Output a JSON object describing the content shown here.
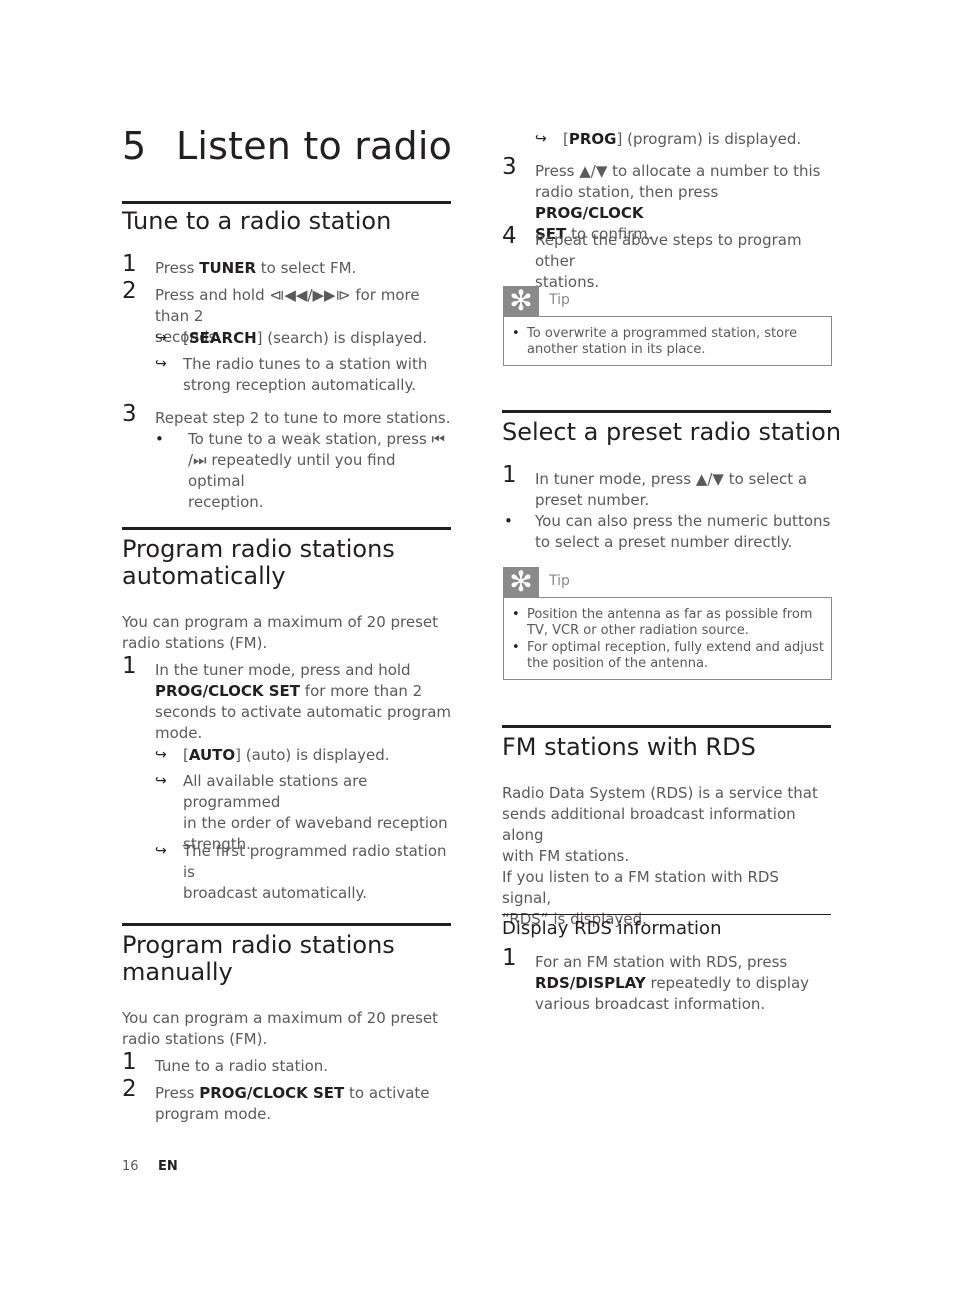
{
  "chapter": {
    "number": "5",
    "title": "Listen to radio"
  },
  "sections": {
    "tune": {
      "title": "Tune to a radio station",
      "steps": [
        {
          "n": "1",
          "pre": "Press ",
          "key": "TUNER",
          "post": " to select FM."
        },
        {
          "n": "2",
          "text": "Press and hold ⧏◀◀/▶▶⧐ for more than 2\nseconds."
        },
        {
          "n": "3",
          "text": "Repeat step 2 to tune to more stations."
        }
      ],
      "results": [
        {
          "pre": "[",
          "key": "SEARCH",
          "post": "] (search) is displayed."
        },
        {
          "text": "The radio tunes to a station with\nstrong reception automatically."
        }
      ],
      "bullets": [
        {
          "text": "To tune to a weak station, press ⏮\n/⏭ repeatedly until you find optimal\nreception."
        }
      ]
    },
    "auto": {
      "title": "Program radio stations\nautomatically",
      "intro": "You can program a maximum of 20 preset\nradio stations (FM).",
      "steps": [
        {
          "n": "1",
          "pre": "In the tuner mode, press and hold\n",
          "key": "PROG/CLOCK SET",
          "post": " for more than 2\nseconds to activate automatic program\nmode."
        }
      ],
      "results": [
        {
          "pre": "[",
          "key": "AUTO",
          "post": "] (auto) is displayed."
        },
        {
          "text": "All available stations are programmed\nin the order of waveband reception\nstrength."
        },
        {
          "text": "The first programmed radio station is\nbroadcast automatically."
        }
      ]
    },
    "manual": {
      "title": "Program radio stations\nmanually",
      "intro": "You can program a maximum of 20 preset\nradio stations (FM).",
      "steps": [
        {
          "n": "1",
          "text": "Tune to a radio station."
        },
        {
          "n": "2",
          "pre": "Press ",
          "key": "PROG/CLOCK SET",
          "post": " to activate\nprogram mode."
        },
        {
          "n": "3",
          "pre": "Press ▲/▼ to allocate a number to this\nradio station, then press ",
          "key": "PROG/CLOCK\nSET",
          "post": " to confirm."
        },
        {
          "n": "4",
          "text": "Repeat the above steps to program other\nstations."
        }
      ],
      "results": [
        {
          "pre": "[",
          "key": "PROG",
          "post": "] (program) is displayed."
        }
      ],
      "tip": {
        "label": "Tip",
        "icon": "asterisk-tip-icon",
        "bullets": [
          "To overwrite a programmed station, store\nanother station in its place."
        ]
      }
    },
    "preset": {
      "title": "Select a preset radio station",
      "steps": [
        {
          "n": "1",
          "text": "In tuner mode, press ▲/▼ to select a\npreset number."
        }
      ],
      "bullets": [
        {
          "text": "You can also press the numeric buttons\nto select a preset number directly."
        }
      ],
      "tip": {
        "label": "Tip",
        "icon": "asterisk-tip-icon",
        "bullets": [
          "Position the antenna as far as possible from\nTV, VCR or other radiation source.",
          "For optimal reception, fully extend and adjust\nthe position of the antenna."
        ]
      }
    },
    "rds": {
      "title": "FM stations with RDS",
      "intro": "Radio Data System (RDS) is a service that\nsends additional broadcast information along\nwith FM stations.\nIf you listen to a FM station with RDS signal,\n“RDS” is displayed.",
      "subsection": {
        "title": "Display RDS information",
        "steps": [
          {
            "n": "1",
            "pre": "For an FM station with RDS, press\n",
            "key": "RDS/DISPLAY",
            "post": " repeatedly to display\nvarious broadcast information."
          }
        ]
      }
    }
  },
  "footer": {
    "page": "16",
    "lang": "EN"
  },
  "symbols": {
    "arrow": "↪",
    "bullet": "•",
    "asterisk": "✻"
  },
  "colors": {
    "heading": "#231f20",
    "body": "#5a5a5a",
    "tip_gray": "#8a8a8a"
  }
}
